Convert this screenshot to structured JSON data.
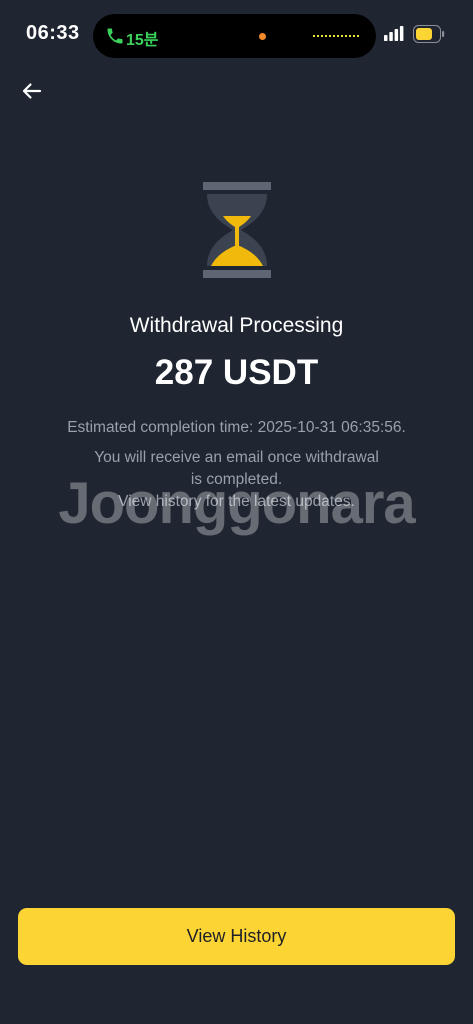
{
  "status_bar": {
    "time": "06:33",
    "call_duration": "15분",
    "colors": {
      "call_green": "#3bd25b",
      "mic_dot": "#f58a2a",
      "battery": "#fcd535"
    }
  },
  "nav": {
    "back_icon": "arrow-left-icon"
  },
  "status": {
    "icon": "hourglass-icon",
    "title": "Withdrawal Processing",
    "amount": "287 USDT",
    "eta": "Estimated completion time: 2025-10-31 06:35:56.",
    "info_line1": "You will receive an email once withdrawal",
    "info_line2": "is completed.",
    "info_line3": "View history for the latest updates."
  },
  "watermark": "Joonggonara",
  "actions": {
    "view_history_label": "View History",
    "accent": "#fcd535"
  }
}
